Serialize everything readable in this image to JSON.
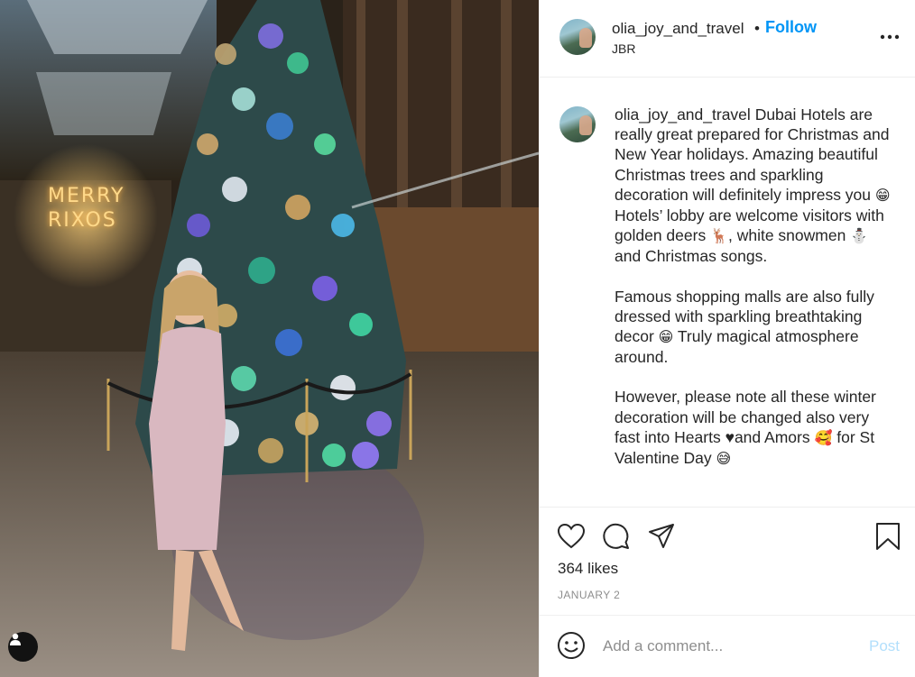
{
  "post": {
    "username": "olia_joy_and_travel",
    "separator": "•",
    "follow_label": "Follow",
    "location": "JBR"
  },
  "caption": {
    "username": "olia_joy_and_travel",
    "p1_a": "Dubai Hotels are really great prepared for Christmas and New Year holidays. Amazing beautiful Christmas trees and sparkling decoration will definitely impress you ",
    "p1_emoji1": "😁",
    "p1_b": " Hotels’ lobby are welcome visitors with golden deers ",
    "p1_emoji2": "🦌",
    "p1_c": ", white snowmen ",
    "p1_emoji3": "⛄",
    "p1_d": " and Christmas songs.",
    "p2_a": "Famous shopping malls are also fully dressed with sparkling breathtaking decor ",
    "p2_emoji": "😁",
    "p2_b": " Truly magical atmosphere around.",
    "p3_a": "However, please note all these winter decoration will be changed also very fast into Hearts ",
    "p3_heart": "♥",
    "p3_b": "and Amors ",
    "p3_emoji1": "🥰",
    "p3_c": " for St Valentine Day ",
    "p3_emoji2": "😅"
  },
  "stats": {
    "likes": "364 likes",
    "date": "JANUARY 2"
  },
  "comment": {
    "placeholder": "Add a comment...",
    "post_label": "Post"
  },
  "photo": {
    "signs": {
      "merry": "MERRY",
      "rixos": "RIXOS"
    }
  },
  "icons": {
    "more": "more-options-icon",
    "like": "heart-icon",
    "comment": "comment-icon",
    "share": "paper-plane-icon",
    "save": "bookmark-icon",
    "emoji": "smiley-icon",
    "user_tag": "user-tag-icon"
  },
  "colors": {
    "follow": "#0095f6",
    "post_disabled": "#b2dffc",
    "muted": "#8e8e8e",
    "text": "#262626"
  }
}
